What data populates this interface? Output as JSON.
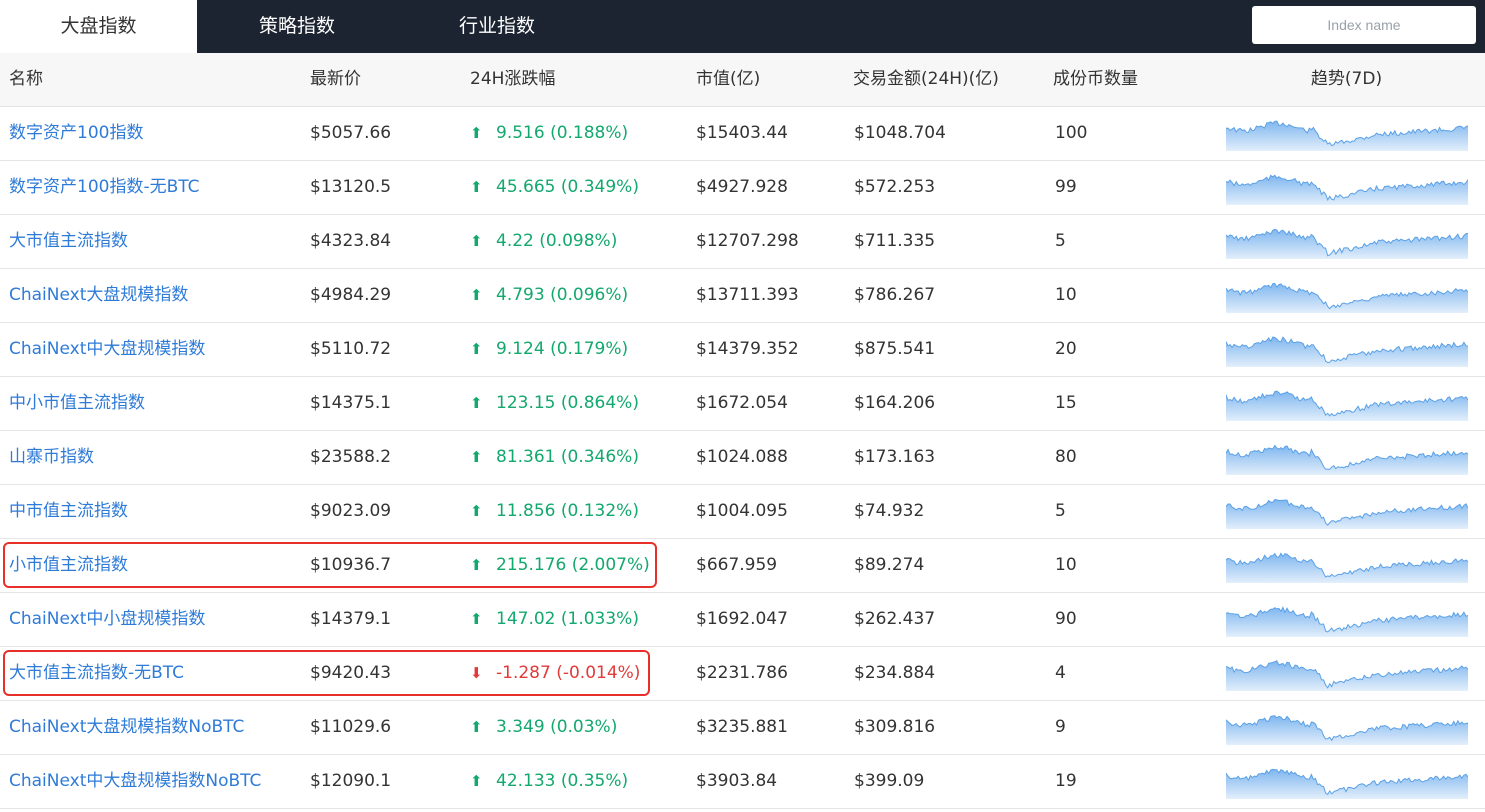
{
  "tabs": [
    {
      "label": "大盘指数",
      "active": true
    },
    {
      "label": "策略指数",
      "active": false
    },
    {
      "label": "行业指数",
      "active": false
    }
  ],
  "search": {
    "placeholder": "Index name"
  },
  "columns": {
    "name": "名称",
    "price": "最新价",
    "change": "24H涨跌幅",
    "market_cap": "市值(亿)",
    "volume": "交易金额(24H)(亿)",
    "constituents": "成份币数量",
    "trend": "趋势(7D)"
  },
  "colors": {
    "up": "#13a86d",
    "down": "#e23a3a",
    "link": "#2f7bd8",
    "spark_line": "#5aa0e6",
    "highlight": "#e8302a"
  },
  "rows": [
    {
      "name": "数字资产100指数",
      "price": "$5057.66",
      "change": "9.516 (0.188%)",
      "direction": "up",
      "market_cap": "$15403.44",
      "volume": "$1048.704",
      "constituents": "100",
      "highlighted": false
    },
    {
      "name": "数字资产100指数-无BTC",
      "price": "$13120.5",
      "change": "45.665 (0.349%)",
      "direction": "up",
      "market_cap": "$4927.928",
      "volume": "$572.253",
      "constituents": "99",
      "highlighted": false
    },
    {
      "name": "大市值主流指数",
      "price": "$4323.84",
      "change": "4.22 (0.098%)",
      "direction": "up",
      "market_cap": "$12707.298",
      "volume": "$711.335",
      "constituents": "5",
      "highlighted": false
    },
    {
      "name": "ChaiNext大盘规模指数",
      "price": "$4984.29",
      "change": "4.793 (0.096%)",
      "direction": "up",
      "market_cap": "$13711.393",
      "volume": "$786.267",
      "constituents": "10",
      "highlighted": false
    },
    {
      "name": "ChaiNext中大盘规模指数",
      "price": "$5110.72",
      "change": "9.124 (0.179%)",
      "direction": "up",
      "market_cap": "$14379.352",
      "volume": "$875.541",
      "constituents": "20",
      "highlighted": false
    },
    {
      "name": "中小市值主流指数",
      "price": "$14375.1",
      "change": "123.15 (0.864%)",
      "direction": "up",
      "market_cap": "$1672.054",
      "volume": "$164.206",
      "constituents": "15",
      "highlighted": false
    },
    {
      "name": "山寨币指数",
      "price": "$23588.2",
      "change": "81.361 (0.346%)",
      "direction": "up",
      "market_cap": "$1024.088",
      "volume": "$173.163",
      "constituents": "80",
      "highlighted": false
    },
    {
      "name": "中市值主流指数",
      "price": "$9023.09",
      "change": "11.856 (0.132%)",
      "direction": "up",
      "market_cap": "$1004.095",
      "volume": "$74.932",
      "constituents": "5",
      "highlighted": false
    },
    {
      "name": "小市值主流指数",
      "price": "$10936.7",
      "change": "215.176 (2.007%)",
      "direction": "up",
      "market_cap": "$667.959",
      "volume": "$89.274",
      "constituents": "10",
      "highlighted": true
    },
    {
      "name": "ChaiNext中小盘规模指数",
      "price": "$14379.1",
      "change": "147.02 (1.033%)",
      "direction": "up",
      "market_cap": "$1692.047",
      "volume": "$262.437",
      "constituents": "90",
      "highlighted": false
    },
    {
      "name": "大市值主流指数-无BTC",
      "price": "$9420.43",
      "change": "-1.287 (-0.014%)",
      "direction": "down",
      "market_cap": "$2231.786",
      "volume": "$234.884",
      "constituents": "4",
      "highlighted": true
    },
    {
      "name": "ChaiNext大盘规模指数NoBTC",
      "price": "$11029.6",
      "change": "3.349 (0.03%)",
      "direction": "up",
      "market_cap": "$3235.881",
      "volume": "$309.816",
      "constituents": "9",
      "highlighted": false
    },
    {
      "name": "ChaiNext中大盘规模指数NoBTC",
      "price": "$12090.1",
      "change": "42.133 (0.35%)",
      "direction": "up",
      "market_cap": "$3903.84",
      "volume": "$399.09",
      "constituents": "19",
      "highlighted": false
    }
  ]
}
